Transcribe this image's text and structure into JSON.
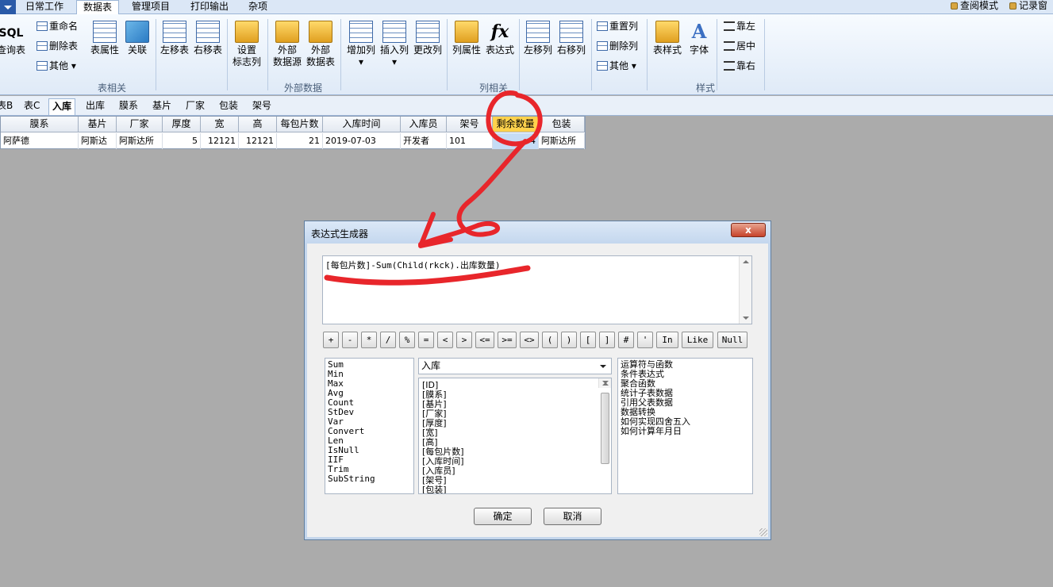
{
  "menu": {
    "tabs": [
      "日常工作",
      "数据表",
      "管理项目",
      "打印输出",
      "杂项"
    ],
    "active_tab": "数据表",
    "right": [
      "查阅模式",
      "记录窗"
    ]
  },
  "ribbon": {
    "sql_query": {
      "top": "SQL",
      "bottom": "查询表"
    },
    "small_table": [
      "重命名",
      "删除表",
      "其他"
    ],
    "table_prop": "表属性",
    "relation": "关联",
    "move_left": "左移表",
    "move_right": "右移表",
    "flag_col": {
      "line1": "设置",
      "line2": "标志列"
    },
    "ext_source": {
      "line1": "外部",
      "line2": "数据源"
    },
    "ext_table": {
      "line1": "外部",
      "line2": "数据表"
    },
    "add_col": "增加列",
    "insert_col": "插入列",
    "modify_col": "更改列",
    "col_prop": "列属性",
    "expression": "表达式",
    "col_left": "左移列",
    "col_right": "右移列",
    "small_col": [
      "重置列",
      "删除列",
      "其他"
    ],
    "table_style": "表样式",
    "font": "字体",
    "align": [
      "靠左",
      "居中",
      "靠右"
    ],
    "groups": {
      "table": "表相关",
      "external": "外部数据",
      "column": "列相关",
      "style": "样式"
    },
    "fx_glyph": "fx",
    "font_glyph": "A"
  },
  "sheet_tabs": [
    "表B",
    "表C",
    "入库",
    "出库",
    "膜系",
    "基片",
    "厂家",
    "包装",
    "架号"
  ],
  "active_sheet": "入库",
  "grid": {
    "headers": [
      "膜系",
      "基片",
      "厂家",
      "厚度",
      "宽",
      "高",
      "每包片数",
      "入库时间",
      "入库员",
      "架号",
      "剩余数量",
      "包装"
    ],
    "row": [
      "阿萨德",
      "阿斯达",
      "阿斯达所",
      "5",
      "12121",
      "12121",
      "21",
      "2019-07-03",
      "开发者",
      "101",
      "-4",
      "阿斯达所"
    ]
  },
  "dialog": {
    "title": "表达式生成器",
    "close_label": "x",
    "expression": "[每包片数]-Sum(Child(rkck).出库数量)",
    "operators": [
      "+",
      "-",
      "*",
      "/",
      "%",
      "=",
      "<",
      ">",
      "<=",
      ">=",
      "<>",
      "(",
      ")",
      "[",
      "]",
      "#",
      "'",
      "In",
      "Like",
      "Null"
    ],
    "functions": [
      "Sum",
      "Min",
      "Max",
      "Avg",
      "Count",
      "StDev",
      "Var",
      "Convert",
      "Len",
      "IsNull",
      "IIF",
      "Trim",
      "SubString"
    ],
    "table_selected": "入库",
    "fields": [
      "[ID]",
      "[膜系]",
      "[基片]",
      "[厂家]",
      "[厚度]",
      "[宽]",
      "[高]",
      "[每包片数]",
      "[入库时间]",
      "[入库员]",
      "[架号]",
      "[包装]"
    ],
    "help_topics": [
      "运算符与函数",
      "条件表达式",
      "聚合函数",
      "统计子表数据",
      "引用父表数据",
      "数据转换",
      "如何实现四舍五入",
      "如何计算年月日"
    ],
    "ok": "确定",
    "cancel": "取消"
  },
  "colors": {
    "highlight_header": "#ffd24c",
    "annotation": "#e8262b",
    "workspace": "#ababab"
  }
}
